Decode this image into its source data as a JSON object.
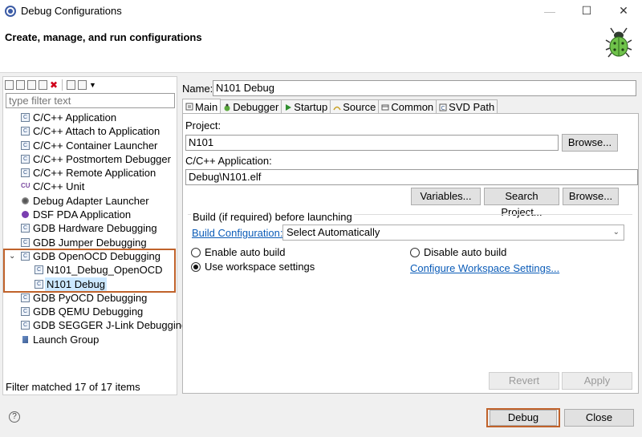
{
  "window": {
    "title": "Debug Configurations",
    "minimize": "—",
    "maximize": "☐",
    "close": "✕"
  },
  "banner": {
    "heading": "Create, manage, and run configurations",
    "icon": "bug-icon"
  },
  "left": {
    "toolbar_icons": [
      "new-config-icon",
      "new-prototype-icon",
      "export-icon",
      "duplicate-icon",
      "delete-icon",
      "collapse-all-icon",
      "filter-icon",
      "view-menu-icon"
    ],
    "filter_placeholder": "type filter text",
    "tree": [
      {
        "label": "C/C++ Application",
        "icon": "c-config-icon",
        "level": 0
      },
      {
        "label": "C/C++ Attach to Application",
        "icon": "c-config-icon",
        "level": 0
      },
      {
        "label": "C/C++ Container Launcher",
        "icon": "c-config-icon",
        "level": 0
      },
      {
        "label": "C/C++ Postmortem Debugger",
        "icon": "c-config-icon",
        "level": 0
      },
      {
        "label": "C/C++ Remote Application",
        "icon": "c-config-icon",
        "level": 0
      },
      {
        "label": "C/C++ Unit",
        "icon": "cu-icon",
        "level": 0
      },
      {
        "label": "Debug Adapter Launcher",
        "icon": "debug-adapter-icon",
        "level": 0
      },
      {
        "label": "DSF PDA Application",
        "icon": "dsf-icon",
        "level": 0
      },
      {
        "label": "GDB Hardware Debugging",
        "icon": "c-config-icon",
        "level": 0
      },
      {
        "label": "GDB Jumper Debugging",
        "icon": "c-config-icon",
        "level": 0
      },
      {
        "label": "GDB OpenOCD Debugging",
        "icon": "c-config-icon",
        "level": 0,
        "expanded": true
      },
      {
        "label": "N101_Debug_OpenOCD",
        "icon": "c-config-icon",
        "level": 1
      },
      {
        "label": "N101 Debug",
        "icon": "c-config-icon",
        "level": 1,
        "selected": true
      },
      {
        "label": "GDB PyOCD Debugging",
        "icon": "c-config-icon",
        "level": 0
      },
      {
        "label": "GDB QEMU Debugging",
        "icon": "c-config-icon",
        "level": 0
      },
      {
        "label": "GDB SEGGER J-Link Debugging",
        "icon": "c-config-icon",
        "level": 0
      },
      {
        "label": "Launch Group",
        "icon": "launch-group-icon",
        "level": 0
      }
    ],
    "status": "Filter matched 17 of 17 items"
  },
  "right": {
    "name_label": "Name:",
    "name_value": "N101 Debug",
    "tabs": [
      {
        "label": "Main",
        "icon": "main-tab-icon",
        "active": true
      },
      {
        "label": "Debugger",
        "icon": "debugger-tab-icon"
      },
      {
        "label": "Startup",
        "icon": "startup-tab-icon"
      },
      {
        "label": "Source",
        "icon": "source-tab-icon"
      },
      {
        "label": "Common",
        "icon": "common-tab-icon"
      },
      {
        "label": "SVD Path",
        "icon": "svd-tab-icon"
      }
    ],
    "project_label": "Project:",
    "project_value": "N101",
    "browse_label": "Browse...",
    "app_label": "C/C++ Application:",
    "app_value": "Debug\\N101.elf",
    "variables_label": "Variables...",
    "search_project_label": "Search Project...",
    "browse2_label": "Browse...",
    "build_group_title": "Build (if required) before launching",
    "build_config_link": "Build Configuration:",
    "build_config_value": "Select Automatically",
    "enable_auto_build": "Enable auto build",
    "disable_auto_build": "Disable auto build",
    "use_workspace": "Use workspace settings",
    "configure_workspace_link": "Configure Workspace Settings...",
    "revert_label": "Revert",
    "apply_label": "Apply"
  },
  "footer": {
    "help": "?",
    "debug_label": "Debug",
    "close_label": "Close"
  }
}
